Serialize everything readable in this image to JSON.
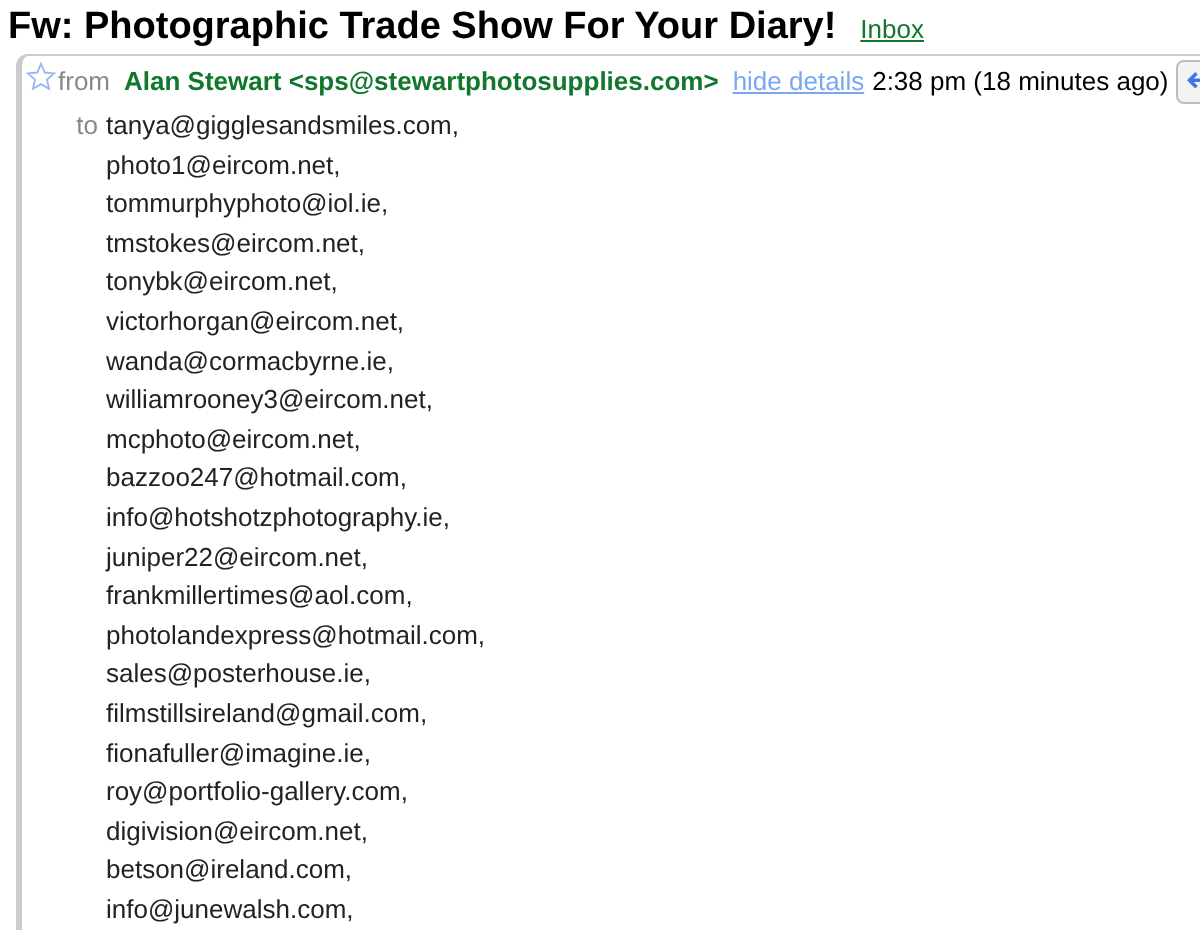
{
  "subject": "Fw: Photographic Trade Show For Your Diary!",
  "label": "Inbox",
  "message": {
    "starred": false,
    "from_label": "from",
    "sender": "Alan Stewart <sps@stewartphotosupplies.com>",
    "details_link": "hide details",
    "time": "2:38 pm (18 minutes ago)",
    "to_label": "to",
    "recipients": [
      "tanya@gigglesandsmiles.com,",
      "photo1@eircom.net,",
      "tommurphyphoto@iol.ie,",
      "tmstokes@eircom.net,",
      "tonybk@eircom.net,",
      "victorhorgan@eircom.net,",
      "wanda@cormacbyrne.ie,",
      "williamrooney3@eircom.net,",
      "mcphoto@eircom.net,",
      "bazzoo247@hotmail.com,",
      "info@hotshotzphotography.ie,",
      "juniper22@eircom.net,",
      "frankmillertimes@aol.com,",
      "photolandexpress@hotmail.com,",
      "sales@posterhouse.ie,",
      "filmstillsireland@gmail.com,",
      "fionafuller@imagine.ie,",
      "roy@portfolio-gallery.com,",
      "digivision@eircom.net,",
      "betson@ireland.com,",
      "info@junewalsh.com,"
    ]
  }
}
